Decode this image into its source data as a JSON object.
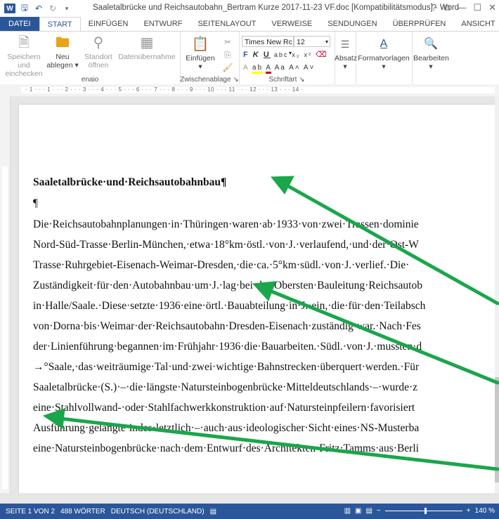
{
  "window": {
    "title": "Saaletalbrücke und Reichsautobahn_Bertram Kurze 2017-11-23 VF.doc [Kompatibilitätsmodus] - Word",
    "controls": [
      "?",
      "⧉",
      "—",
      "☐",
      "✕"
    ]
  },
  "tabs": [
    "DATEI",
    "START",
    "EINFÜGEN",
    "ENTWURF",
    "SEITENLAYOUT",
    "VERWEISE",
    "SENDUNGEN",
    "ÜBERPRÜFEN",
    "ANSICHT"
  ],
  "active_tab": "START",
  "ribbon": {
    "enaio": {
      "label": "enaio",
      "save": "Speichern und\neinchecken",
      "new_line1": "Neu",
      "new_line2": "ablegen",
      "location_line1": "Standort",
      "location_line2": "öffnen",
      "data_import": "Datenübernahme"
    },
    "clipboard": {
      "label": "Zwischenablage",
      "paste": "Einfügen"
    },
    "font": {
      "label": "Schriftart",
      "name": "Times New Rc",
      "size": "12",
      "bold": "F",
      "italic": "K",
      "underline": "U"
    },
    "paragraph": "Absatz",
    "styles": "Formatvorlagen",
    "editing": "Bearbeiten"
  },
  "ruler_text": "· 1 · · · 1 · · · 2 · · · 3 · · · 4 · · · 5 · · · 6 · · · 7 · · · 8 · · · 9 · · · 10 · · · 11 · · · 12 · · · 13 · · · 14 ·",
  "document": {
    "heading": "Saaletalbrücke·und·Reichsautobahnbau¶",
    "empty_para": "¶",
    "lines": [
      "Die·Reichsautobahnplanungen·in·Thüringen·waren·ab·1933·von·zwei·Trassen·dominie",
      "Nord-Süd-Trasse·Berlin-München,·etwa·18°km·östl.·von·J.·verlaufend,·und·der·Ost-W",
      "Trasse·Ruhrgebiet-Eisenach-Weimar-Dresden,·die·ca.·5°km·südl.·von·J.·verlief.·Die·",
      "Zuständigkeit·für·den·Autobahnbau·um·J.·lag·bei·der·Obersten·Bauleitung·Reichsautob",
      "in·Halle/Saale.·Diese·setzte·1936·eine·örtl.·Bauabteilung·in·J.·ein,·die·für·den·Teilabsch",
      "von·Dorna·bis·Weimar·der·Reichsautobahn·Dresden-Eisenach·zuständig·war.·Nach·Fes",
      "der·Linienführung·begannen·im·Frühjahr·1936·die·Bauarbeiten.·Südl.·von·J.·mussten·d",
      "→°Saale,·das·weiträumige·Tal·und·zwei·wichtige·Bahnstrecken·überquert·werden.·Für",
      "Saaletalbrücke·(S.)·–·die·längste·Natursteinbogenbrücke·Mitteldeutschlands·–·wurde·z",
      "eine·Stahlvollwand-·oder·Stahlfachwerkkonstruktion·auf·Natursteinpfeilern·favorisiert",
      "Ausführung·gelangte·indes·letztlich·–·auch·aus·ideologischer·Sicht·eines·NS-Musterba",
      "eine·Natursteinbogenbrücke·nach·dem·Entwurf·des·Architekten·Fritz·Tamms·aus·Berli"
    ]
  },
  "status": {
    "page": "SEITE 1 VON 2",
    "words": "488 WÖRTER",
    "language": "DEUTSCH (DEUTSCHLAND)",
    "zoom": "140 %"
  },
  "annotation_color": "#1aa64b"
}
